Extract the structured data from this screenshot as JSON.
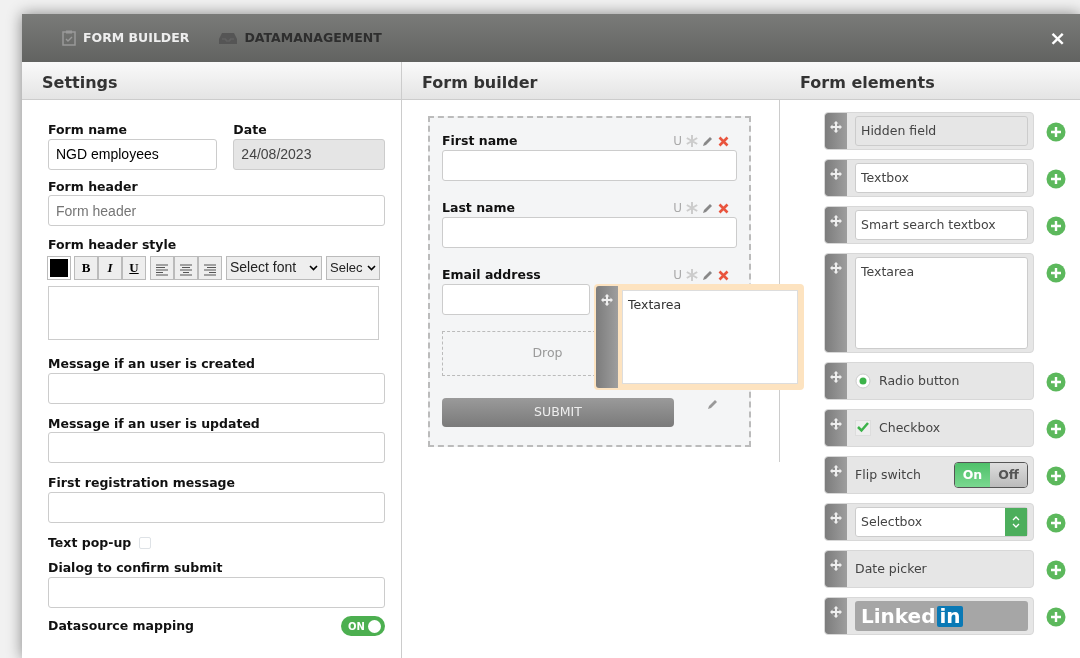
{
  "tabs": [
    {
      "label": "FORM BUILDER",
      "selected": true
    },
    {
      "label": "DATAMANAGEMENT",
      "selected": false
    }
  ],
  "close": "×",
  "columns": [
    "Settings",
    "Form builder",
    "Form elements"
  ],
  "settings": {
    "form_name": {
      "label": "Form name",
      "value": "NGD employees"
    },
    "date": {
      "label": "Date",
      "value": "24/08/2023",
      "disabled": true
    },
    "form_header": {
      "label": "Form header",
      "placeholder": "Form header"
    },
    "header_style": {
      "label": "Form header style",
      "buttons": [
        "B",
        "I",
        "U"
      ],
      "font_select": "Select font",
      "size_select": "Selec"
    },
    "fields": [
      {
        "kind": "text",
        "label": "Message if an user is created"
      },
      {
        "kind": "text",
        "label": "Message if an user is updated"
      },
      {
        "kind": "text",
        "label": "First registration message"
      },
      {
        "kind": "check",
        "label": "Text pop-up",
        "checked": false
      },
      {
        "kind": "text",
        "label": "Dialog to confirm submit"
      },
      {
        "kind": "switch",
        "label": "Datasource mapping",
        "on": true,
        "text": "ON"
      }
    ]
  },
  "builder": {
    "fields": [
      {
        "label": "First name",
        "flag": "U"
      },
      {
        "label": "Last name",
        "flag": "U"
      },
      {
        "label": "Email address",
        "flag": "U"
      }
    ],
    "drop_zone": "Drop",
    "submit": "SUBMIT"
  },
  "dragging": {
    "label": "Textarea"
  },
  "elements": [
    {
      "kind": "hidden",
      "label": "Hidden field"
    },
    {
      "kind": "textbox",
      "label": "Textbox"
    },
    {
      "kind": "textbox",
      "label": "Smart search textbox"
    },
    {
      "kind": "textarea",
      "label": "Textarea"
    },
    {
      "kind": "radio",
      "label": "Radio button",
      "selected": true
    },
    {
      "kind": "checkbox",
      "label": "Checkbox",
      "checked": true
    },
    {
      "kind": "flip",
      "label": "Flip switch",
      "on": true,
      "on_text": "On",
      "off_text": "Off"
    },
    {
      "kind": "select",
      "label": "Selectbox"
    },
    {
      "kind": "plain",
      "label": "Date picker"
    },
    {
      "kind": "linkedin",
      "label": "Linked",
      "badge": "in"
    }
  ]
}
